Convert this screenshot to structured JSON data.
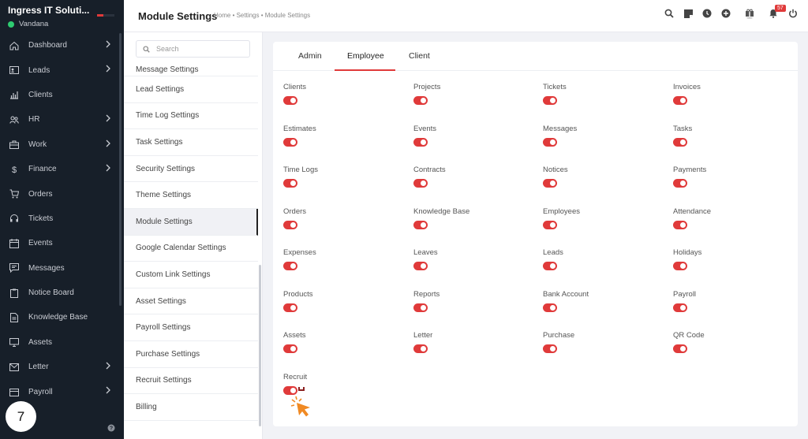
{
  "sidebar": {
    "brand": "Ingress IT Soluti...",
    "user": "Vandana",
    "items": [
      {
        "label": "Dashboard",
        "icon": "home-icon",
        "arrow": true
      },
      {
        "label": "Leads",
        "icon": "id-card-icon",
        "arrow": true
      },
      {
        "label": "Clients",
        "icon": "bar-chart-icon",
        "arrow": false
      },
      {
        "label": "HR",
        "icon": "people-icon",
        "arrow": true
      },
      {
        "label": "Work",
        "icon": "briefcase-icon",
        "arrow": true
      },
      {
        "label": "Finance",
        "icon": "dollar-icon",
        "arrow": true
      },
      {
        "label": "Orders",
        "icon": "cart-icon",
        "arrow": false
      },
      {
        "label": "Tickets",
        "icon": "headset-icon",
        "arrow": false
      },
      {
        "label": "Events",
        "icon": "calendar-icon",
        "arrow": false
      },
      {
        "label": "Messages",
        "icon": "chat-icon",
        "arrow": false
      },
      {
        "label": "Notice Board",
        "icon": "clipboard-icon",
        "arrow": false
      },
      {
        "label": "Knowledge Base",
        "icon": "document-icon",
        "arrow": false
      },
      {
        "label": "Assets",
        "icon": "monitor-icon",
        "arrow": false
      },
      {
        "label": "Letter",
        "icon": "envelope-icon",
        "arrow": true
      },
      {
        "label": "Payroll",
        "icon": "wallet-icon",
        "arrow": true
      }
    ],
    "step_number": "7"
  },
  "header": {
    "title": "Module Settings",
    "breadcrumb": "Home • Settings • Module Settings",
    "notification_count": "57"
  },
  "settings_menu": {
    "search_placeholder": "Search",
    "items": [
      "Message Settings",
      "Lead Settings",
      "Time Log Settings",
      "Task Settings",
      "Security Settings",
      "Theme Settings",
      "Module Settings",
      "Google Calendar Settings",
      "Custom Link Settings",
      "Asset Settings",
      "Payroll Settings",
      "Purchase Settings",
      "Recruit Settings",
      "Billing"
    ],
    "active": "Module Settings"
  },
  "tabs": [
    "Admin",
    "Employee",
    "Client"
  ],
  "active_tab": "Employee",
  "modules": [
    {
      "label": "Clients",
      "enabled": true
    },
    {
      "label": "Projects",
      "enabled": true
    },
    {
      "label": "Tickets",
      "enabled": true
    },
    {
      "label": "Invoices",
      "enabled": true
    },
    {
      "label": "Estimates",
      "enabled": true
    },
    {
      "label": "Events",
      "enabled": true
    },
    {
      "label": "Messages",
      "enabled": true
    },
    {
      "label": "Tasks",
      "enabled": true
    },
    {
      "label": "Time Logs",
      "enabled": true
    },
    {
      "label": "Contracts",
      "enabled": true
    },
    {
      "label": "Notices",
      "enabled": true
    },
    {
      "label": "Payments",
      "enabled": true
    },
    {
      "label": "Orders",
      "enabled": true
    },
    {
      "label": "Knowledge Base",
      "enabled": true
    },
    {
      "label": "Employees",
      "enabled": true
    },
    {
      "label": "Attendance",
      "enabled": true
    },
    {
      "label": "Expenses",
      "enabled": true
    },
    {
      "label": "Leaves",
      "enabled": true
    },
    {
      "label": "Leads",
      "enabled": true
    },
    {
      "label": "Holidays",
      "enabled": true
    },
    {
      "label": "Products",
      "enabled": true
    },
    {
      "label": "Reports",
      "enabled": true
    },
    {
      "label": "Bank Account",
      "enabled": true
    },
    {
      "label": "Payroll",
      "enabled": true
    },
    {
      "label": "Assets",
      "enabled": true
    },
    {
      "label": "Letter",
      "enabled": true
    },
    {
      "label": "Purchase",
      "enabled": true
    },
    {
      "label": "QR Code",
      "enabled": true
    },
    {
      "label": "Recruit",
      "enabled": true
    }
  ],
  "colors": {
    "accent": "#e03a3a",
    "sidebar_bg": "#171f29"
  }
}
